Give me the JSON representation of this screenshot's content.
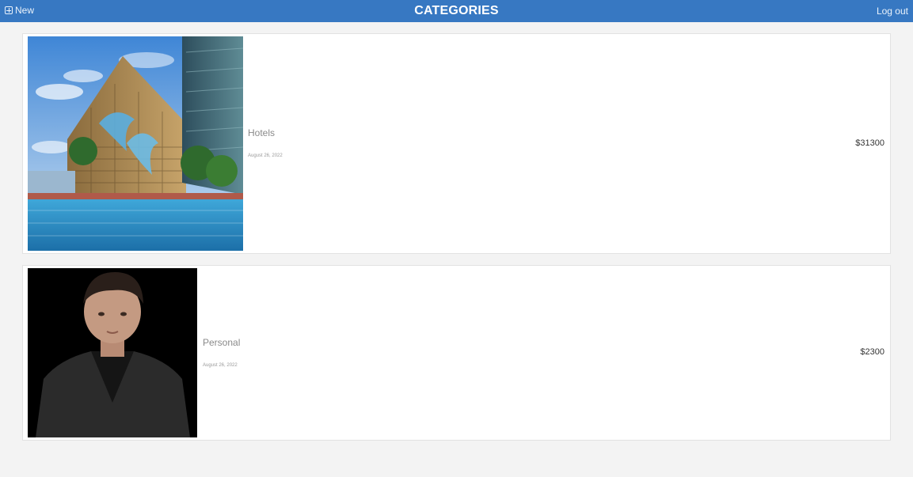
{
  "header": {
    "new_label": "New",
    "title": "CATEGORIES",
    "logout_label": "Log out",
    "background": "#3778c2"
  },
  "categories": [
    {
      "name": "Hotels",
      "date": "August 26, 2022",
      "amount": "$31300",
      "image": "hotel-building-pool-photo"
    },
    {
      "name": "Personal",
      "date": "August 26, 2022",
      "amount": "$2300",
      "image": "person-portrait-photo"
    }
  ]
}
